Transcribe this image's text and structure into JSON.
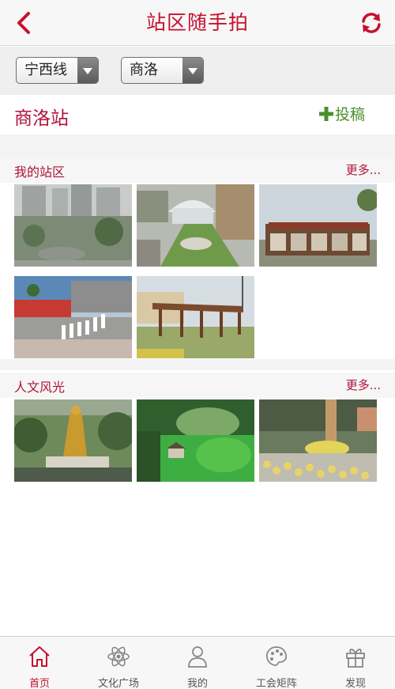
{
  "header": {
    "title": "站区随手拍"
  },
  "filters": {
    "line_value": "宁西线",
    "station_value": "商洛"
  },
  "station": {
    "name": "商洛站",
    "submit_label": "投稿"
  },
  "sections": [
    {
      "title": "我的站区",
      "more": "更多..."
    },
    {
      "title": "人文风光",
      "more": "更多..."
    }
  ],
  "tabs": [
    {
      "label": "首页",
      "icon": "home-icon",
      "active": true
    },
    {
      "label": "文化广场",
      "icon": "atom-icon",
      "active": false
    },
    {
      "label": "我的",
      "icon": "person-icon",
      "active": false
    },
    {
      "label": "工会矩阵",
      "icon": "palette-icon",
      "active": false
    },
    {
      "label": "发现",
      "icon": "gift-icon",
      "active": false
    }
  ],
  "colors": {
    "accent": "#c8102e",
    "submit_green": "#4a8f2c"
  }
}
